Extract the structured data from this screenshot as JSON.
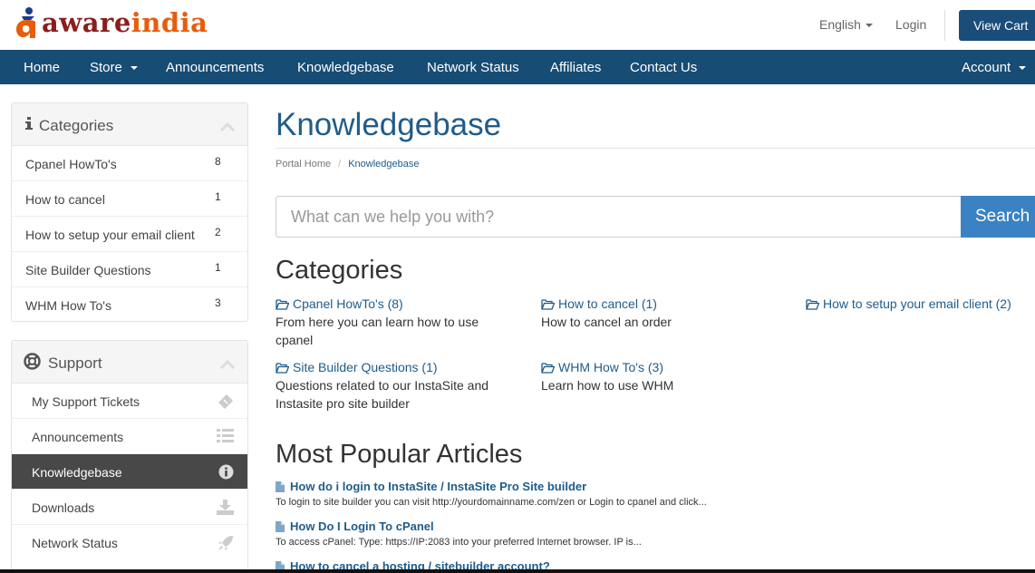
{
  "brand": {
    "logo_aware": "aware",
    "logo_india": "india",
    "color_aware": "#8b1d1d",
    "color_india": "#e85d0a"
  },
  "header": {
    "language": "English",
    "login": "Login",
    "view_cart": "View Cart"
  },
  "nav": {
    "items": [
      "Home",
      "Store",
      "Announcements",
      "Knowledgebase",
      "Network Status",
      "Affiliates",
      "Contact Us"
    ],
    "account": "Account",
    "color": "#174c74"
  },
  "sidebar": {
    "categories": {
      "title": "Categories",
      "items": [
        {
          "label": "Cpanel HowTo's",
          "count": "8"
        },
        {
          "label": "How to cancel",
          "count": "1"
        },
        {
          "label": "How to setup your email client",
          "count": "2"
        },
        {
          "label": "Site Builder Questions",
          "count": "1"
        },
        {
          "label": "WHM How To's",
          "count": "3"
        }
      ]
    },
    "support": {
      "title": "Support",
      "items": [
        {
          "label": "My Support Tickets",
          "icon": "ticket-icon"
        },
        {
          "label": "Announcements",
          "icon": "list-icon"
        },
        {
          "label": "Knowledgebase",
          "icon": "info-circle-icon",
          "active": true
        },
        {
          "label": "Downloads",
          "icon": "download-icon"
        },
        {
          "label": "Network Status",
          "icon": "rocket-icon"
        }
      ]
    }
  },
  "main": {
    "title": "Knowledgebase",
    "breadcrumb": {
      "home": "Portal Home",
      "separator": "/",
      "current": "Knowledgebase"
    },
    "search": {
      "placeholder": "What can we help you with?",
      "button": "Search"
    },
    "categories_heading": "Categories",
    "categories": [
      {
        "title": "Cpanel HowTo's (8)",
        "desc": "From here you can learn how to use cpanel"
      },
      {
        "title": "How to cancel (1)",
        "desc": "How to cancel an order"
      },
      {
        "title": "How to setup your email client (2)",
        "desc": ""
      },
      {
        "title": "Site Builder Questions (1)",
        "desc": "Questions related to our InstaSite and Instasite pro site builder"
      },
      {
        "title": "WHM How To's (3)",
        "desc": "Learn how to use WHM"
      }
    ],
    "popular_heading": "Most Popular Articles",
    "articles": [
      {
        "title": "How do i login to InstaSite / InstaSite Pro Site builder",
        "snippet": "To login to site builder you can visit http://yourdomainname.com/zen or Login to cpanel and click..."
      },
      {
        "title": "How Do I Login To cPanel",
        "snippet": "To access cPanel: Type: https://IP:2083 into your preferred Internet browser. IP is..."
      },
      {
        "title": "How to cancel a hosting / sitebuilder account?",
        "snippet": ""
      }
    ]
  },
  "colors": {
    "link": "#1f5c8b",
    "search_button": "#3a82c3",
    "active_item": "#484848"
  }
}
